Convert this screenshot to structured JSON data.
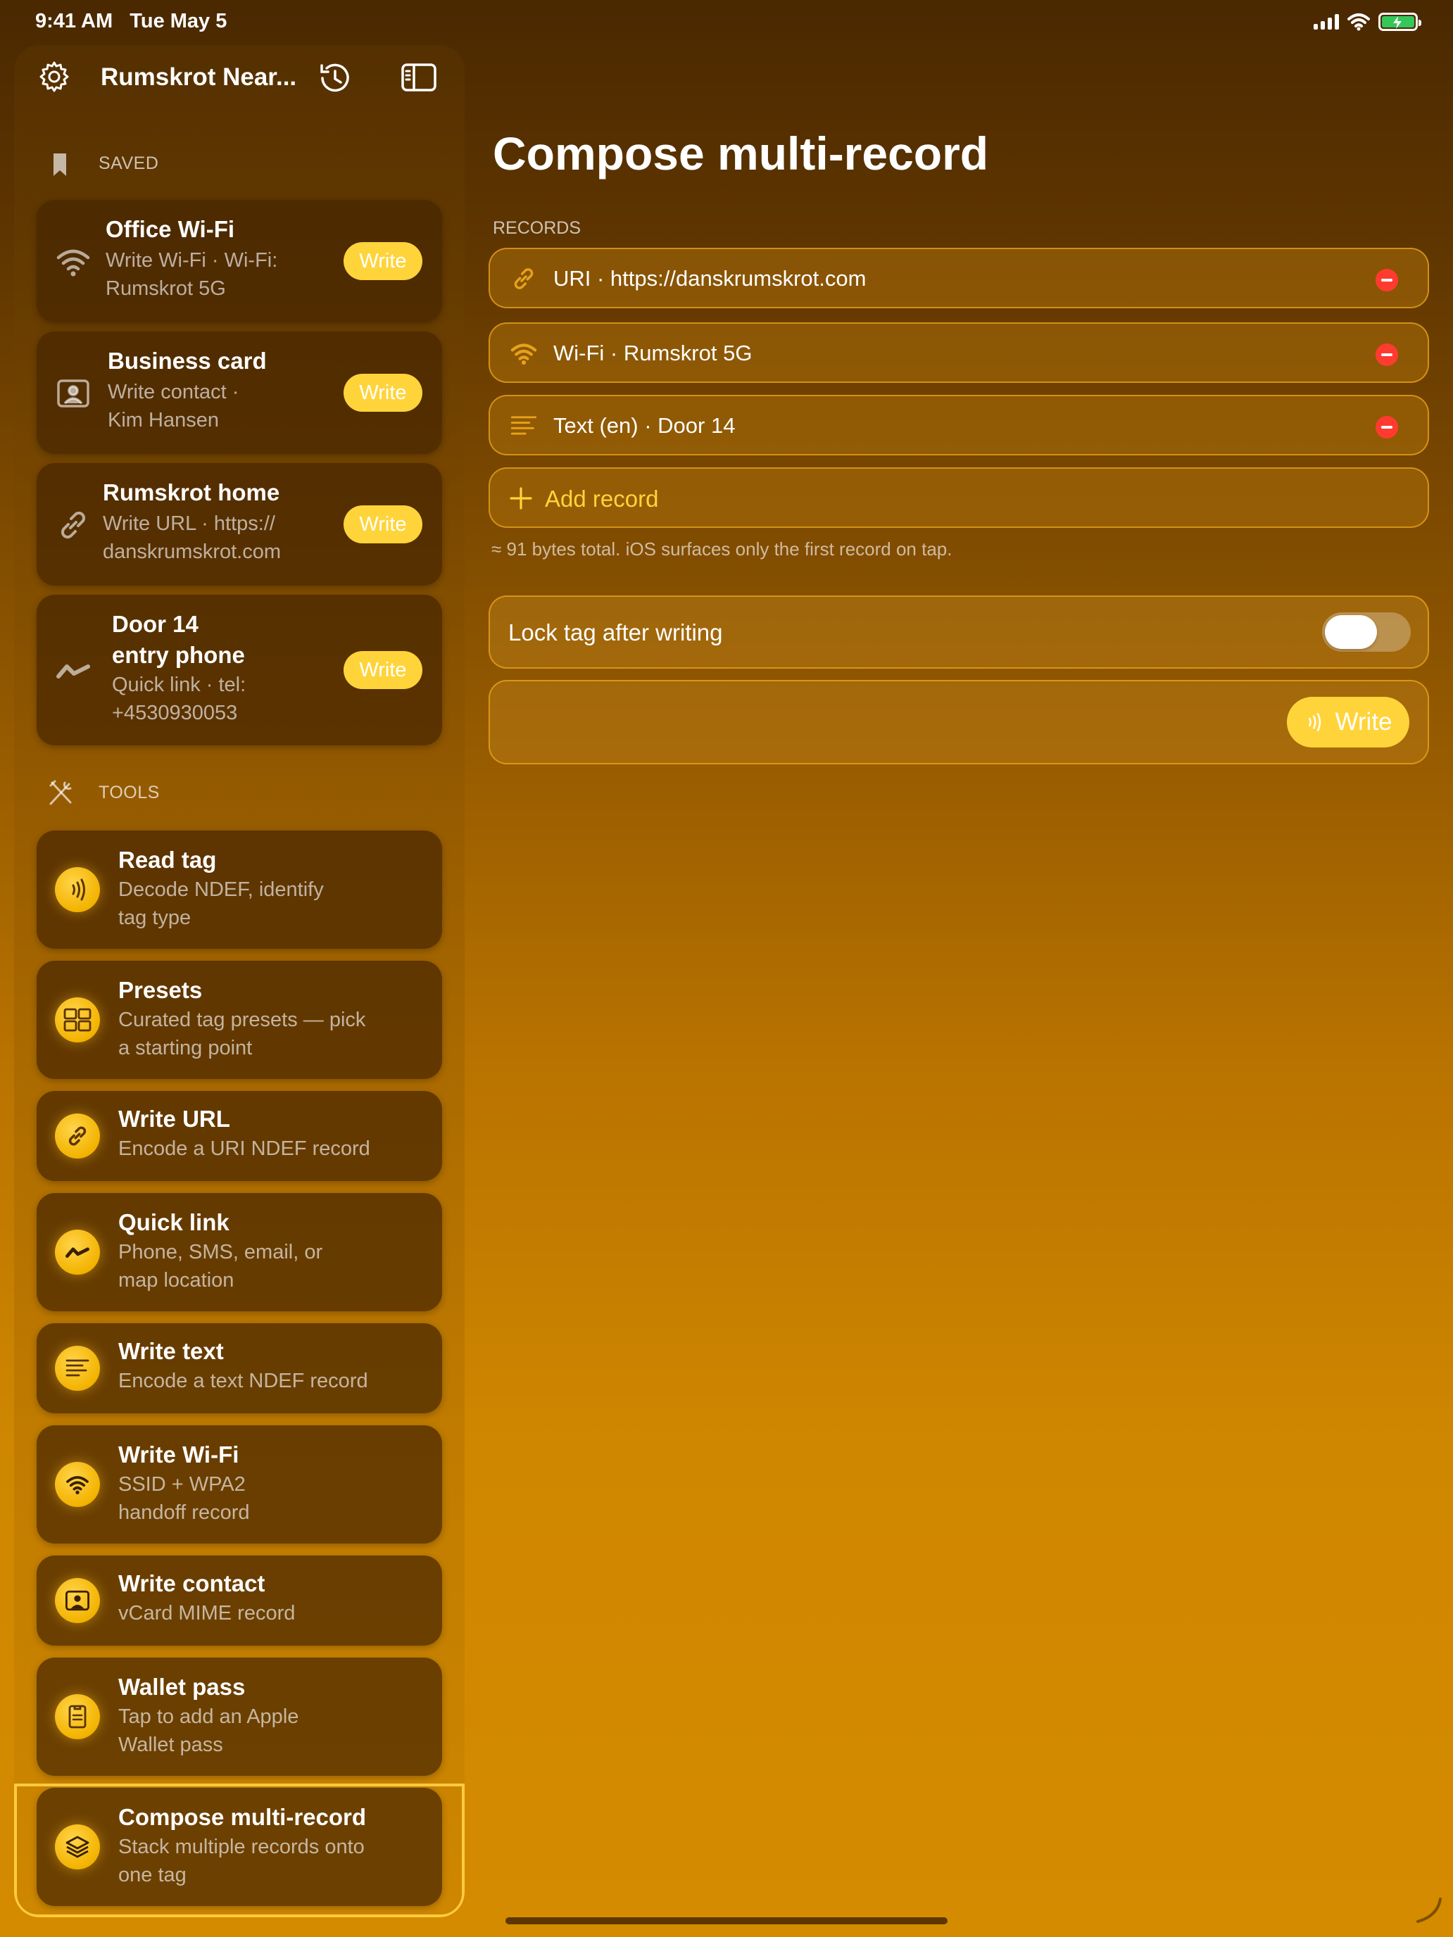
{
  "status_bar": {
    "time_date": "9:41 AM   Tue May 5"
  },
  "sidebar": {
    "title": "Rumskrot Near...",
    "saved_label": "SAVED",
    "saved": [
      {
        "title": "Office Wi-Fi",
        "sub1": "Write Wi-Fi · Wi-Fi:",
        "sub2": "Rumskrot 5G",
        "action": "Write",
        "icon": "wifi-icon"
      },
      {
        "title": "Business card",
        "sub1": "Write contact ·",
        "sub2": "Kim Hansen",
        "action": "Write",
        "icon": "contact-card-icon"
      },
      {
        "title": "Rumskrot home",
        "sub1": "Write URL · https://",
        "sub2": "danskrumskrot.com",
        "action": "Write",
        "icon": "link-icon"
      },
      {
        "title1": "Door 14",
        "title2": "entry phone",
        "sub1": "Quick link · tel:",
        "sub2": "+4530930053",
        "action": "Write",
        "icon": "quick-link-icon"
      }
    ],
    "tools_label": "TOOLS",
    "tools": [
      {
        "title": "Read tag",
        "sub1": "Decode NDEF, identify",
        "sub2": "tag type",
        "icon": "nfc-read-icon"
      },
      {
        "title": "Presets",
        "sub1": "Curated tag presets — pick",
        "sub2": "a starting point",
        "icon": "grid-icon"
      },
      {
        "title": "Write URL",
        "sub1": "Encode a URI NDEF record",
        "icon": "link-icon"
      },
      {
        "title": "Quick link",
        "sub1": "Phone, SMS, email, or",
        "sub2": "map location",
        "icon": "quick-link-icon"
      },
      {
        "title": "Write text",
        "sub1": "Encode a text NDEF record",
        "icon": "text-lines-icon"
      },
      {
        "title": "Write Wi-Fi",
        "sub1": "SSID + WPA2",
        "sub2": "handoff record",
        "icon": "wifi-icon"
      },
      {
        "title": "Write contact",
        "sub1": "vCard MIME record",
        "icon": "contact-card-icon"
      },
      {
        "title": "Wallet pass",
        "sub1": "Tap to add an Apple",
        "sub2": "Wallet pass",
        "icon": "wallet-pass-icon"
      },
      {
        "title": "Compose multi-record",
        "sub1": "Stack multiple records onto",
        "sub2": "one tag",
        "icon": "layers-icon",
        "selected": true
      }
    ]
  },
  "main": {
    "title": "Compose multi-record",
    "records_label": "RECORDS",
    "records": [
      {
        "text": "URI · https://danskrumskrot.com",
        "icon": "link-icon"
      },
      {
        "text": "Wi-Fi · Rumskrot 5G",
        "icon": "wifi-icon"
      },
      {
        "text": "Text (en) · Door 14",
        "icon": "text-lines-icon"
      }
    ],
    "add_record_label": "Add record",
    "bytes_note": "≈ 91 bytes total. iOS surfaces only the first record on tap.",
    "lock_label": "Lock tag after writing",
    "lock_enabled": false,
    "write_label": "Write"
  },
  "colors": {
    "accent": "#ffd43a",
    "remove": "#ff3b30",
    "battery": "#34c759"
  }
}
